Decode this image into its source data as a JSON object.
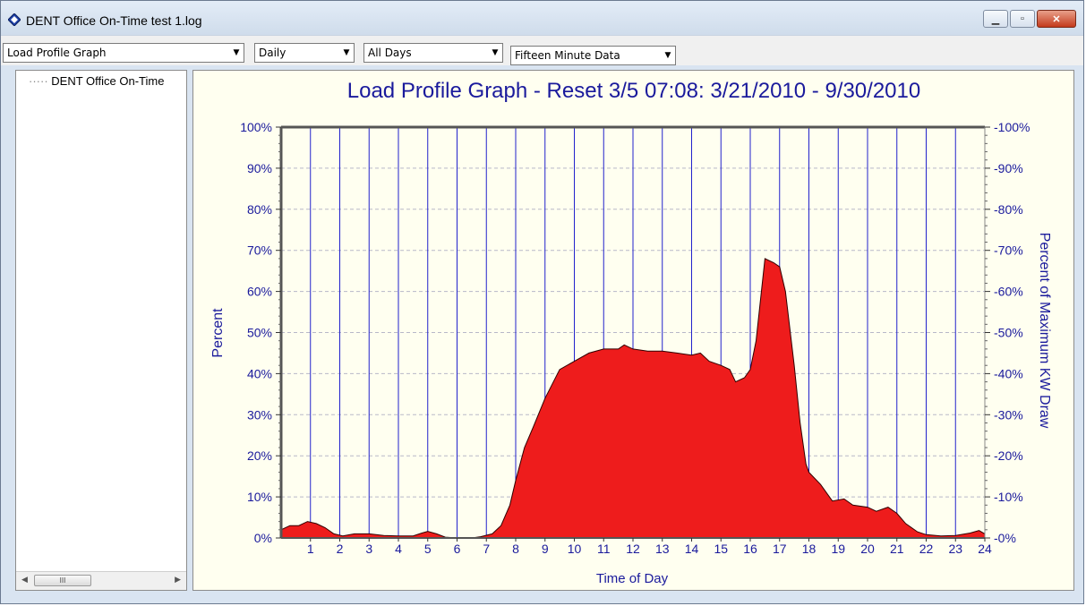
{
  "window": {
    "title": "DENT Office On-Time test 1.log",
    "controls": [
      "minimize",
      "maximize",
      "close"
    ]
  },
  "toolbar": {
    "graph_type": "Load Profile Graph",
    "period": "Daily",
    "days": "All Days",
    "data_interval": "Fifteen Minute Data"
  },
  "tree": {
    "items": [
      "DENT Office On-Time"
    ],
    "scroll_thumb_label": "III"
  },
  "icons": {
    "app": "app-diamond-icon",
    "minimize": "minimize-icon",
    "maximize": "maximize-icon",
    "close": "close-icon"
  },
  "colors": {
    "area_fill": "#ee1c1c",
    "grid": "#2222cc",
    "text": "#1a1a9c",
    "plot_bg": "#fffff0"
  },
  "chart_data": {
    "type": "area",
    "title": "Load Profile Graph - Reset 3/5 07:08:  3/21/2010 - 9/30/2010",
    "xlabel": "Time of Day",
    "ylabel": "Percent",
    "y2label": "Percent of Maximum KW Draw",
    "xlim": [
      0,
      24
    ],
    "ylim": [
      0,
      100
    ],
    "xticks": [
      "1",
      "2",
      "3",
      "4",
      "5",
      "6",
      "7",
      "8",
      "9",
      "10",
      "11",
      "12",
      "13",
      "14",
      "15",
      "16",
      "17",
      "18",
      "19",
      "20",
      "21",
      "22",
      "23",
      "24"
    ],
    "yticks": [
      "0%",
      "10%",
      "20%",
      "30%",
      "40%",
      "50%",
      "60%",
      "70%",
      "80%",
      "90%",
      "100%"
    ],
    "y2ticks": [
      "0%",
      "10%",
      "20%",
      "30%",
      "40%",
      "50%",
      "60%",
      "70%",
      "80%",
      "90%",
      "100%"
    ],
    "grid": true,
    "series": [
      {
        "values": [
          [
            0,
            2
          ],
          [
            0.3,
            3
          ],
          [
            0.6,
            3
          ],
          [
            0.9,
            4
          ],
          [
            1.2,
            3.5
          ],
          [
            1.5,
            2.5
          ],
          [
            1.8,
            1
          ],
          [
            2.1,
            0.5
          ],
          [
            2.5,
            1
          ],
          [
            3,
            1
          ],
          [
            3.5,
            0.6
          ],
          [
            4,
            0.5
          ],
          [
            4.5,
            0.5
          ],
          [
            4.8,
            1.2
          ],
          [
            5,
            1.6
          ],
          [
            5.3,
            1
          ],
          [
            5.6,
            0.2
          ],
          [
            6,
            0
          ],
          [
            6.5,
            0
          ],
          [
            6.8,
            0.3
          ],
          [
            7.2,
            1
          ],
          [
            7.5,
            3
          ],
          [
            7.8,
            8
          ],
          [
            8,
            14
          ],
          [
            8.3,
            22
          ],
          [
            8.6,
            27
          ],
          [
            9,
            34
          ],
          [
            9.5,
            41
          ],
          [
            10,
            43
          ],
          [
            10.5,
            45
          ],
          [
            11,
            46
          ],
          [
            11.5,
            46
          ],
          [
            11.7,
            47
          ],
          [
            12,
            46
          ],
          [
            12.5,
            45.5
          ],
          [
            13,
            45.5
          ],
          [
            13.5,
            45
          ],
          [
            14,
            44.5
          ],
          [
            14.3,
            45
          ],
          [
            14.6,
            43
          ],
          [
            15,
            42
          ],
          [
            15.3,
            41
          ],
          [
            15.5,
            38
          ],
          [
            15.8,
            39
          ],
          [
            16,
            41
          ],
          [
            16.2,
            48
          ],
          [
            16.5,
            68
          ],
          [
            16.8,
            67
          ],
          [
            17,
            66
          ],
          [
            17.2,
            60
          ],
          [
            17.5,
            42
          ],
          [
            17.7,
            28
          ],
          [
            17.9,
            18
          ],
          [
            18,
            16
          ],
          [
            18.4,
            13
          ],
          [
            18.8,
            9
          ],
          [
            19.2,
            9.5
          ],
          [
            19.5,
            8
          ],
          [
            20,
            7.5
          ],
          [
            20.3,
            6.5
          ],
          [
            20.7,
            7.5
          ],
          [
            21,
            6
          ],
          [
            21.3,
            3.5
          ],
          [
            21.7,
            1.5
          ],
          [
            22,
            0.8
          ],
          [
            22.5,
            0.5
          ],
          [
            23,
            0.6
          ],
          [
            23.5,
            1.2
          ],
          [
            23.8,
            1.8
          ],
          [
            24,
            1
          ]
        ]
      }
    ]
  }
}
